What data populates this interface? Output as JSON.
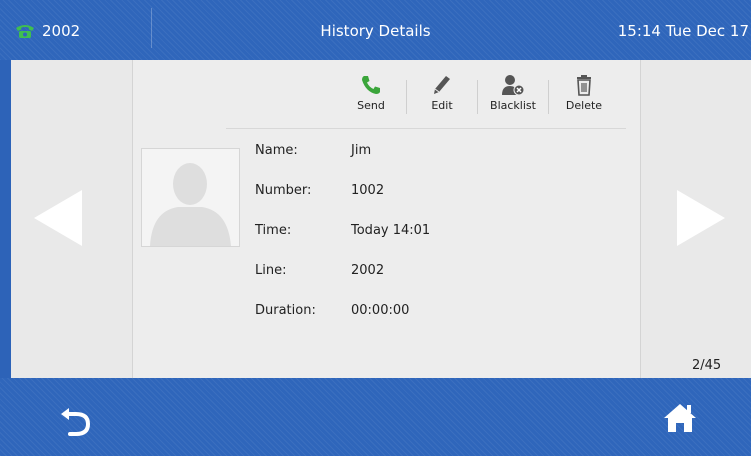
{
  "topbar": {
    "line_number": "2002",
    "title": "History Details",
    "clock": "15:14 Tue Dec 17"
  },
  "toolbar": {
    "send_label": "Send",
    "edit_label": "Edit",
    "blacklist_label": "Blacklist",
    "delete_label": "Delete"
  },
  "details": {
    "name_label": "Name:",
    "name_value": "Jim",
    "number_label": "Number:",
    "number_value": "1002",
    "time_label": "Time:",
    "time_value": "Today 14:01",
    "line_label": "Line:",
    "line_value": "2002",
    "duration_label": "Duration:",
    "duration_value": "00:00:00"
  },
  "pager": {
    "counter": "2/45"
  },
  "icons": {
    "line_status": "phone-icon",
    "send": "phone-call-icon",
    "edit": "pencil-icon",
    "blacklist": "blacklist-user-icon",
    "delete": "trash-icon",
    "back": "back-arrow-icon",
    "home": "home-icon"
  },
  "colors": {
    "header_blue": "#2f66bb",
    "panel_bg": "#eeeeee",
    "call_green": "#3aa53a"
  }
}
